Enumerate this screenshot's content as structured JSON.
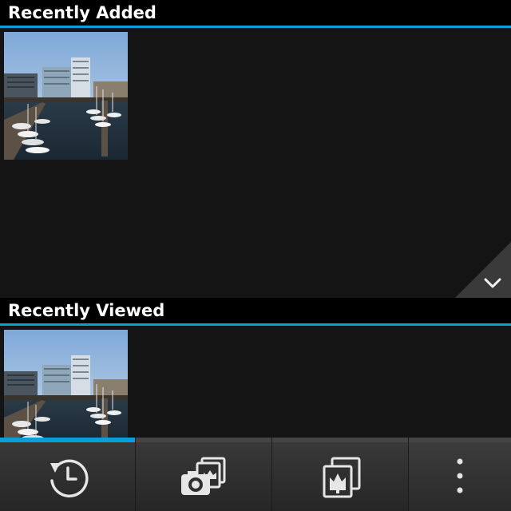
{
  "sections": {
    "recently_added": {
      "title": "Recently Added"
    },
    "recently_viewed": {
      "title": "Recently Viewed"
    }
  },
  "icons": {
    "expand": "chevron-down-icon",
    "history": "history-clock-icon",
    "camera_pictures": "camera-pictures-icon",
    "pictures": "pictures-icon",
    "overflow": "more-vertical-icon"
  },
  "colors": {
    "accent": "#0b9fd8",
    "background": "#000000",
    "panel": "#141414",
    "actionbar": "#2b2b2b"
  },
  "actionbar": {
    "active_index": 0
  }
}
